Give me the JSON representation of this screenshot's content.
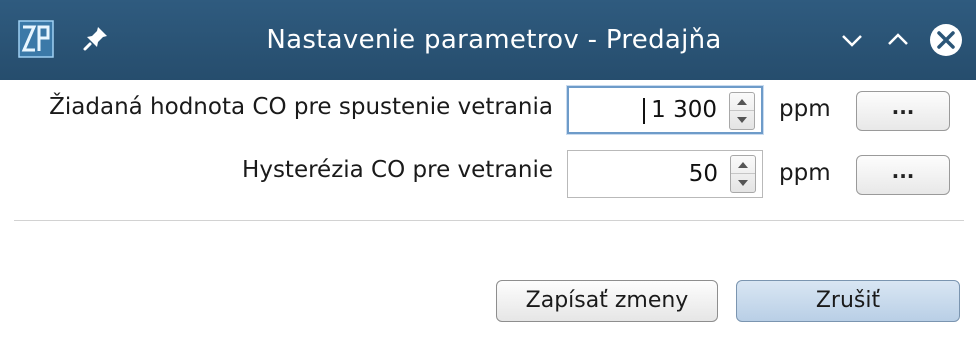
{
  "window": {
    "title": "Nastavenie parametrov - Predajňa",
    "logo_icon": "app-logo-icon",
    "pin_icon": "pin-icon",
    "controls": [
      "chevron-down-icon",
      "chevron-up-icon",
      "close-icon"
    ],
    "titlebar_color": "#2b5577"
  },
  "fields": [
    {
      "label": "Žiadaná hodnota CO pre spustenie vetrania",
      "value": "1 300",
      "unit": "ppm",
      "button_label": "..."
    },
    {
      "label": "Hysterézia CO pre vetranie",
      "value": "50",
      "unit": "ppm",
      "button_label": "..."
    }
  ],
  "actions": {
    "save_label": "Zapísať zmeny",
    "cancel_label": "Zrušiť"
  }
}
